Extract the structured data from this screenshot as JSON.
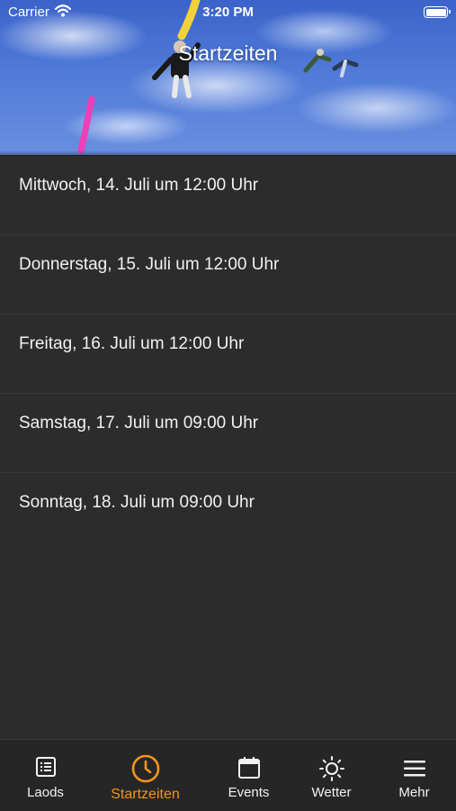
{
  "status_bar": {
    "carrier": "Carrier",
    "time": "3:20 PM"
  },
  "header": {
    "title": "Startzeiten"
  },
  "schedule": [
    {
      "label": "Mittwoch, 14. Juli um 12:00 Uhr"
    },
    {
      "label": "Donnerstag, 15. Juli um 12:00 Uhr"
    },
    {
      "label": "Freitag, 16. Juli um 12:00 Uhr"
    },
    {
      "label": "Samstag, 17. Juli um 09:00 Uhr"
    },
    {
      "label": "Sonntag, 18. Juli um 09:00 Uhr"
    }
  ],
  "tabs": [
    {
      "label": "Laods",
      "icon": "list-icon",
      "active": false
    },
    {
      "label": "Startzeiten",
      "icon": "clock-icon",
      "active": true
    },
    {
      "label": "Events",
      "icon": "calendar-icon",
      "active": false
    },
    {
      "label": "Wetter",
      "icon": "sun-icon",
      "active": false
    },
    {
      "label": "Mehr",
      "icon": "menu-icon",
      "active": false
    }
  ],
  "colors": {
    "accent": "#f5941e",
    "background": "#2c2c2c",
    "tabbar": "#262626"
  }
}
